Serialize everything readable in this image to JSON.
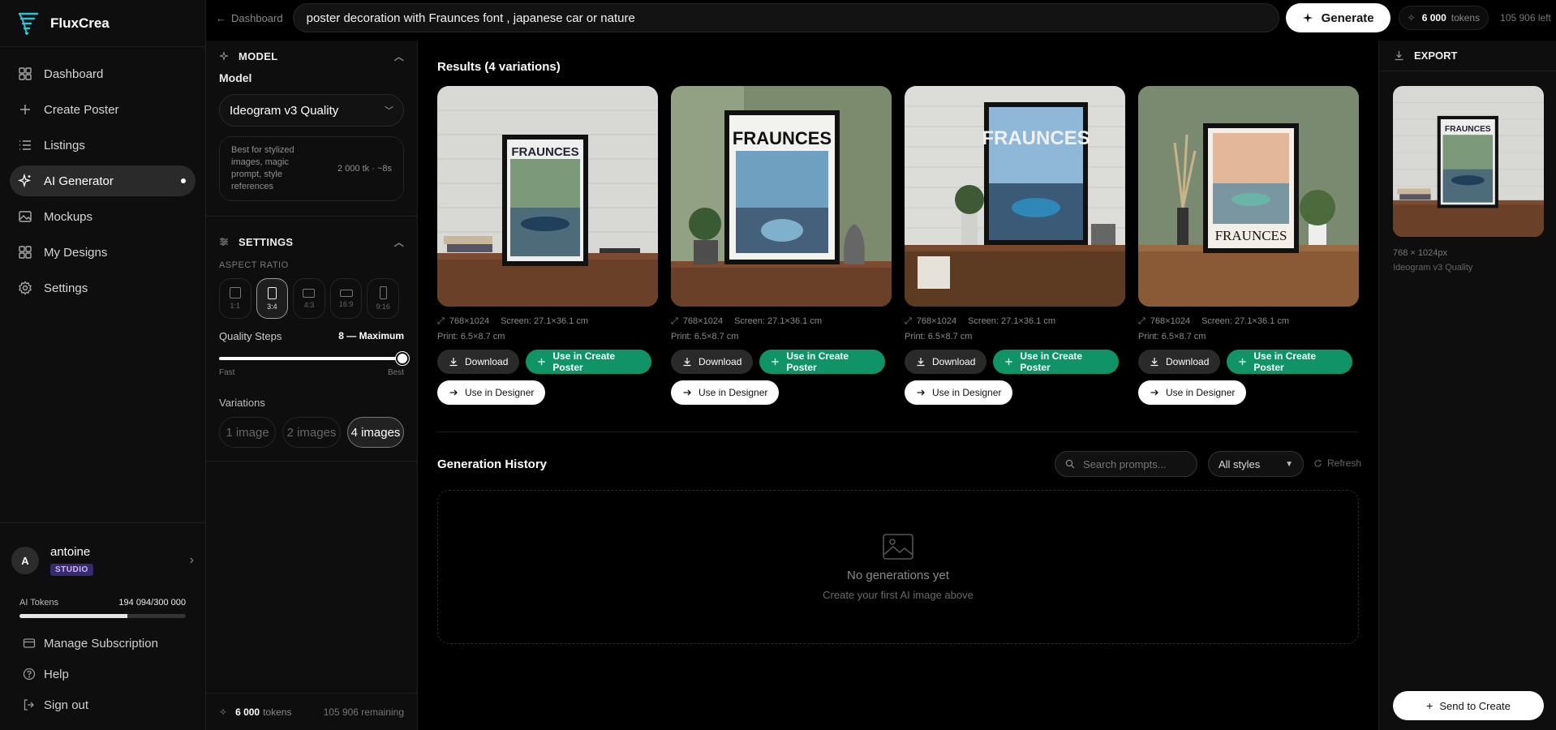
{
  "brand": {
    "name": "FluxCrea"
  },
  "nav": [
    {
      "label": "Dashboard",
      "icon": "grid-icon"
    },
    {
      "label": "Create Poster",
      "icon": "plus-icon"
    },
    {
      "label": "Listings",
      "icon": "list-icon"
    },
    {
      "label": "AI Generator",
      "icon": "sparkle-icon",
      "active": true
    },
    {
      "label": "Mockups",
      "icon": "image-icon"
    },
    {
      "label": "My Designs",
      "icon": "grid-icon"
    },
    {
      "label": "Settings",
      "icon": "gear-icon"
    }
  ],
  "user": {
    "initial": "A",
    "name": "antoine",
    "plan": "STUDIO"
  },
  "ai_tokens": {
    "label": "AI Tokens",
    "value": "194 094/300 000",
    "used_fraction": 0.647
  },
  "side_links": {
    "subscription": "Manage Subscription",
    "help": "Help",
    "signout": "Sign out"
  },
  "topbar": {
    "back_label": "Dashboard",
    "prompt": "poster decoration with Fraunces font , japanese car or nature",
    "generate_label": "Generate",
    "tokens_value": "6 000",
    "tokens_unit": "tokens",
    "left_label": "105 906 left"
  },
  "model_section": {
    "header": "MODEL",
    "label": "Model",
    "selected": "Ideogram v3 Quality",
    "description": "Best for stylized images, magic prompt, style references",
    "meta": "2 000 tk · ~8s"
  },
  "settings_section": {
    "header": "SETTINGS",
    "aspect_label": "ASPECT RATIO",
    "ratios": [
      "1:1",
      "3:4",
      "4:3",
      "16:9",
      "9:16"
    ],
    "selected_ratio": "3:4",
    "quality_label": "Quality Steps",
    "quality_value": "8 — Maximum",
    "slider_min": "Fast",
    "slider_max": "Best",
    "variations_label": "Variations",
    "variations": [
      "1 image",
      "2 images",
      "4 images"
    ],
    "selected_variation": "4 images"
  },
  "panel_footer": {
    "tokens_value": "6 000",
    "tokens_unit": "tokens",
    "remaining": "105 906 remaining"
  },
  "results": {
    "title": "Results (4 variations)",
    "cards": [
      {
        "dims": "768×1024",
        "screen": "Screen: 27.1×36.1 cm",
        "print": "Print: 6.5×8.7 cm",
        "poster_text": "FRAUNCES"
      },
      {
        "dims": "768×1024",
        "screen": "Screen: 27.1×36.1 cm",
        "print": "Print: 6.5×8.7 cm",
        "poster_text": "FRAUNCES"
      },
      {
        "dims": "768×1024",
        "screen": "Screen: 27.1×36.1 cm",
        "print": "Print: 6.5×8.7 cm",
        "poster_text": "FRAUNCES"
      },
      {
        "dims": "768×1024",
        "screen": "Screen: 27.1×36.1 cm",
        "print": "Print: 6.5×8.7 cm",
        "poster_text": "FRAUNCES"
      }
    ],
    "download_label": "Download",
    "create_label": "Use in Create Poster",
    "designer_label": "Use in Designer"
  },
  "history": {
    "title": "Generation History",
    "search_placeholder": "Search prompts...",
    "style_filter": "All styles",
    "refresh_label": "Refresh",
    "empty_title": "No generations yet",
    "empty_sub": "Create your first AI image above"
  },
  "export": {
    "header": "EXPORT",
    "size": "768 × 1024px",
    "model": "Ideogram v3 Quality",
    "poster_text": "FRAUNCES",
    "send_label": "Send to Create"
  },
  "colors": {
    "accent_green": "#109366",
    "badge_purple": "#3b2a6b"
  }
}
